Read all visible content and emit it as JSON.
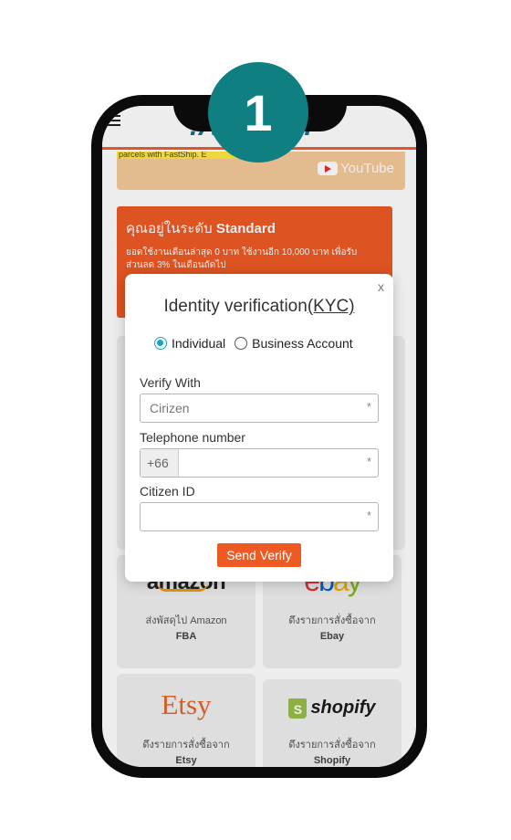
{
  "step_badge": "1",
  "header": {
    "logo_text": ".ASTSHIP",
    "menu_icon": "hamburger-menu-icon"
  },
  "banner": {
    "subtext": "parcels with FastShip. E",
    "video_label": "YouTube",
    "video_icon": "youtube-play-icon"
  },
  "level_card": {
    "title_prefix": "คุณอยู่ในระดับ",
    "level": "Standard",
    "description": "ยอดใช้งานเดือนล่าสุด 0 บาท ใช้งานอีก 10,000 บาท เพื่อรับส่วนลด 3% ในเดือนถัดไป"
  },
  "integrations": [
    {
      "logo": "amazon",
      "label_line1": "ส่งพัสดุไป Amazon",
      "label_line2": "FBA"
    },
    {
      "logo": "ebay",
      "label_line1": "ดึงรายการสั่งซื้อจาก",
      "label_line2": "Ebay"
    },
    {
      "logo": "Etsy",
      "label_line1": "ดึงรายการสั่งซื้อจาก",
      "label_line2": "Etsy"
    },
    {
      "logo": "shopify",
      "label_line1": "ดึงรายการสั่งซื้อจาก",
      "label_line2": "Shopify"
    }
  ],
  "modal": {
    "close_label": "x",
    "title_plain": "Identity verification",
    "title_underlined": "(KYC)",
    "radio_individual": "Individual",
    "radio_business": "Business Account",
    "selected_type": "Individual",
    "verify_with_label": "Verify With",
    "verify_with_value": "Cirizen",
    "telephone_label": "Telephone number",
    "telephone_prefix": "+66",
    "telephone_value": "",
    "citizen_id_label": "Citizen ID",
    "citizen_id_value": "",
    "required_marker": "*",
    "submit_label": "Send Verify"
  },
  "colors": {
    "brand_orange": "#ee5a24",
    "brand_teal": "#0f7f81",
    "logo_blue": "#1f6b8a"
  }
}
